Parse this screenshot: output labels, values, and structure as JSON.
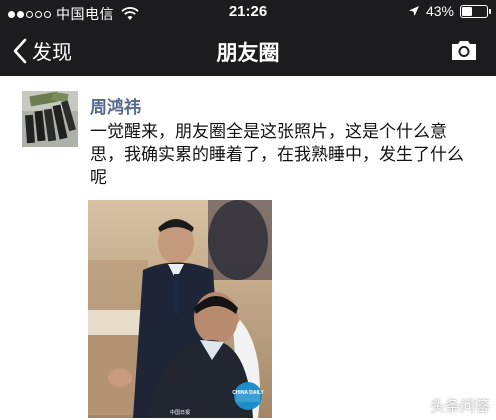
{
  "status_bar": {
    "carrier": "中国电信",
    "time": "21:26",
    "battery": "43%",
    "battery_level": 0.43
  },
  "nav": {
    "back_label": "发现",
    "title": "朋友圈"
  },
  "post": {
    "author": "周鸿祎",
    "text": "一觉醒来，朋友圈全是这张照片，这是个什么意思，我确实累的睡着了，在我熟睡中，发生了什么呢",
    "photo_badge": "CHINA DAILY",
    "photo_caption": "中国日报"
  },
  "watermark": {
    "text": "头条问答"
  },
  "colors": {
    "bar_bg": "#1c1c1f",
    "author": "#55698e"
  }
}
